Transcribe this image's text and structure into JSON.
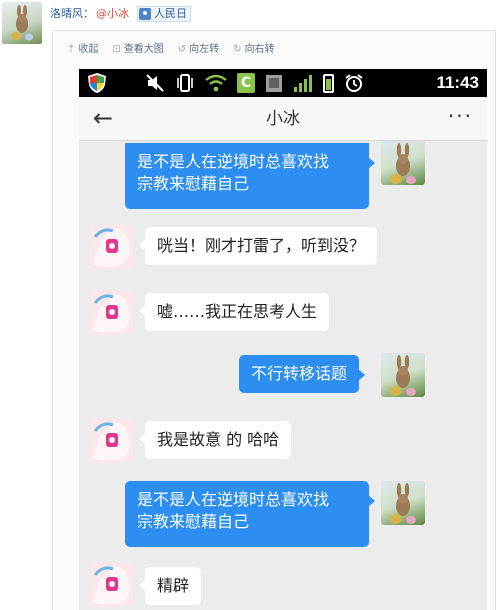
{
  "post": {
    "poster_name": "洛晴风：",
    "mention": "@小冰",
    "location": "人民日",
    "toolbar": [
      {
        "label": "收起",
        "icon": "collapse-icon"
      },
      {
        "label": "查看大图",
        "icon": "zoom-icon"
      },
      {
        "label": "向左转",
        "icon": "rotate-left-icon"
      },
      {
        "label": "向右转",
        "icon": "rotate-right-icon"
      }
    ]
  },
  "phone": {
    "status_time": "11:43",
    "status_icons": [
      "shield-icon",
      "mute-icon",
      "vibrate-icon",
      "wifi-icon",
      "c-app-icon",
      "sim-icon",
      "signal-icon",
      "battery-icon",
      "alarm-icon"
    ],
    "chat_title": "小冰",
    "back_glyph": "←",
    "more_glyph": "···"
  },
  "messages": [
    {
      "sender": "me",
      "lines": [
        "是不是人在逆境时总喜欢找",
        "宗教来慰藉自己"
      ]
    },
    {
      "sender": "bot",
      "lines": [
        "咣当！刚才打雷了，听到没？"
      ]
    },
    {
      "sender": "bot",
      "lines": [
        "嘘……我正在思考人生"
      ]
    },
    {
      "sender": "me",
      "lines": [
        "不行转移话题"
      ]
    },
    {
      "sender": "bot",
      "lines": [
        "我是故意 的 哈哈"
      ]
    },
    {
      "sender": "me",
      "lines": [
        "是不是人在逆境时总喜欢找",
        "宗教来慰藉自己"
      ]
    },
    {
      "sender": "bot",
      "lines": [
        "精辟"
      ]
    }
  ],
  "colors": {
    "my_bubble": "#2c8ef0",
    "bot_bubble": "#ffffff",
    "chat_bg": "#ececec",
    "status_bar": "#000000",
    "mention": "#e0463c",
    "name": "#2a5c9a"
  }
}
